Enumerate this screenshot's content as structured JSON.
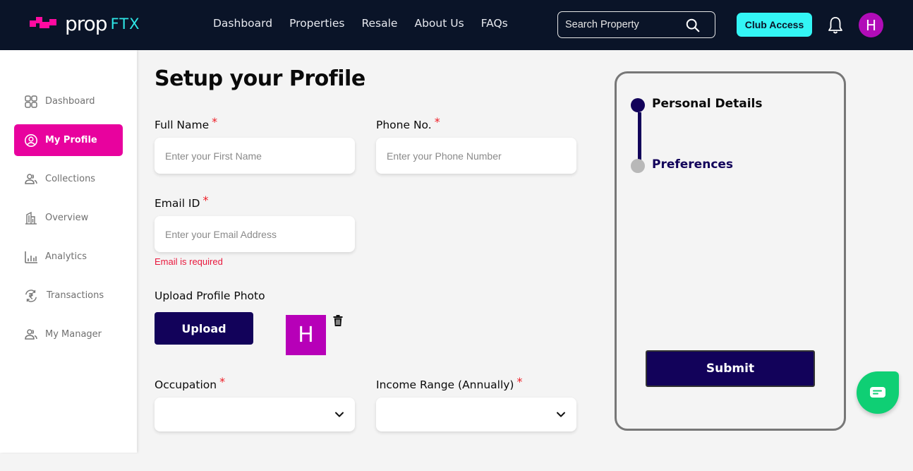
{
  "header": {
    "logo_text": "prop",
    "logo_accent": "FTX",
    "nav": [
      {
        "label": "Dashboard"
      },
      {
        "label": "Properties"
      },
      {
        "label": "Resale"
      },
      {
        "label": "About Us"
      },
      {
        "label": "FAQs"
      }
    ],
    "search_placeholder": "Search Property",
    "club_access_label": "Club Access",
    "avatar_initial": "H"
  },
  "sidebar": {
    "items": [
      {
        "label": "Dashboard",
        "icon": "grid-icon",
        "active": false
      },
      {
        "label": "My Profile",
        "icon": "user-circle-icon",
        "active": true
      },
      {
        "label": "Collections",
        "icon": "users-icon",
        "active": false
      },
      {
        "label": "Overview",
        "icon": "building-icon",
        "active": false
      },
      {
        "label": "Analytics",
        "icon": "bar-chart-icon",
        "active": false
      },
      {
        "label": "Transactions",
        "icon": "rupee-exchange-icon",
        "active": false
      },
      {
        "label": "My Manager",
        "icon": "users-icon",
        "active": false
      }
    ]
  },
  "form": {
    "title": "Setup your Profile",
    "required_mark": "*",
    "full_name": {
      "label": "Full Name",
      "placeholder": "Enter your First Name",
      "value": ""
    },
    "phone": {
      "label": "Phone No.",
      "placeholder": "Enter your Phone Number",
      "value": ""
    },
    "email": {
      "label": "Email ID",
      "placeholder": "Enter your Email Address",
      "value": "",
      "error": "Email is required"
    },
    "photo": {
      "label": "Upload Profile Photo",
      "upload_label": "Upload",
      "preview_initial": "H"
    },
    "occupation": {
      "label": "Occupation",
      "selected": ""
    },
    "income": {
      "label": "Income Range (Annually)",
      "selected": ""
    }
  },
  "stepper": {
    "steps": [
      {
        "label": "Personal Details",
        "status": "active"
      },
      {
        "label": "Preferences",
        "status": "pending"
      }
    ],
    "submit_label": "Submit"
  },
  "colors": {
    "header_bg": "#0a1428",
    "accent_pink": "#e8029e",
    "accent_cyan": "#33f5f5",
    "primary_navy": "#12025a",
    "avatar_purple": "#b10cb8",
    "error_red": "#e8173c",
    "chat_green": "#0fcf74"
  }
}
